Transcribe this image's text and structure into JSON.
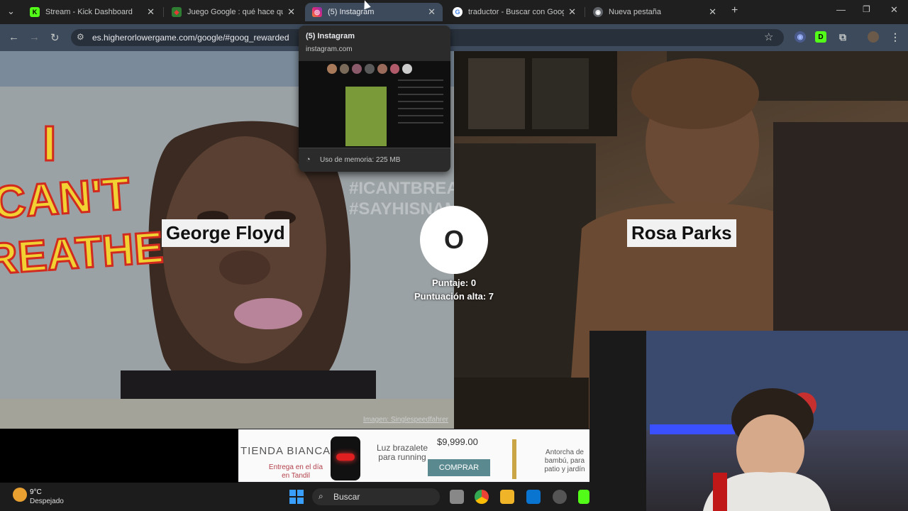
{
  "tabs": [
    {
      "title": "Stream - Kick Dashboard",
      "favicon": "K"
    },
    {
      "title": "Juego Google : qué hace que G",
      "favicon": "◆"
    },
    {
      "title": "(5) Instagram",
      "favicon": "◎"
    },
    {
      "title": "traductor - Buscar con Google",
      "favicon": "G"
    },
    {
      "title": "Nueva pestaña",
      "favicon": "◉"
    }
  ],
  "address_bar": {
    "url": "es.higherorlowergame.com/google/#goog_rewarded"
  },
  "hover_card": {
    "title": "(5) Instagram",
    "domain": "instagram.com",
    "memory": "Uso de memoria: 225 MB"
  },
  "game": {
    "left_name": "George Floyd",
    "right_name": "Rosa Parks",
    "vs": "O",
    "score": "Puntaje: 0",
    "high_score": "Puntuación alta: 7",
    "image_credit": "Imagen: Singlespeedfahrer",
    "left_mural_text": "I CAN'T BREATHE",
    "left_wall_tag": "#ICANTBREATHE #SAYHISNAME"
  },
  "ad": {
    "brand": "TIENDA BIANCA",
    "tagline": "Entrega en el día en Tandil",
    "product1": "Luz brazalete para running",
    "price": "$9,999.00",
    "cta": "COMPRAR",
    "product2": "Antorcha de bambú, para patio y jardín"
  },
  "taskbar": {
    "weather_temp": "9°C",
    "weather_desc": "Despejado",
    "search_placeholder": "Buscar"
  },
  "colors": {
    "tab_active": "#3c4a5c",
    "kick_green": "#53fc18",
    "compra_button": "#5a8a8f"
  }
}
